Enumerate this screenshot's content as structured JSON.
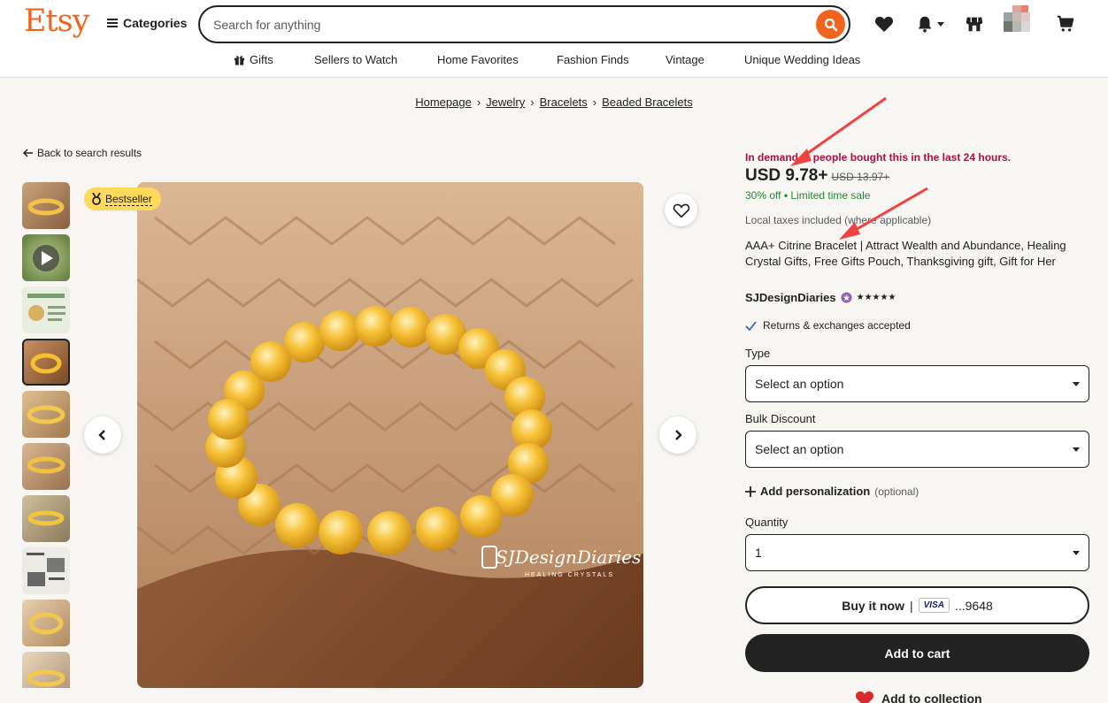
{
  "header": {
    "logo": "Etsy",
    "categories_label": "Categories",
    "search_placeholder": "Search for anything"
  },
  "nav": {
    "items": [
      "Gifts",
      "Sellers to Watch",
      "Home Favorites",
      "Fashion Finds",
      "Vintage",
      "Unique Wedding Ideas"
    ]
  },
  "breadcrumb": [
    "Homepage",
    "Jewelry",
    "Bracelets",
    "Beaded Bracelets"
  ],
  "back_label": "Back to search results",
  "badge": "Bestseller",
  "watermark": {
    "name": "SJDesignDiaries",
    "tagline": "HEALING CRYSTALS"
  },
  "product": {
    "demand": "In demand. 9 people bought this in the last 24 hours.",
    "price": "USD 9.78+",
    "original_price": "USD 13.97+",
    "discount": "30% off",
    "sale_note": "Limited time sale",
    "tax_note": "Local taxes included (where applicable)",
    "title": "AAA+ Citrine Bracelet | Attract Wealth and Abundance, Healing Crystal Gifts, Free Gifts Pouch, Thanksgiving gift, Gift for Her",
    "shop_name": "SJDesignDiaries",
    "rating": 5,
    "stars": "★★★★★",
    "returns": "Returns & exchanges accepted"
  },
  "options": {
    "type_label": "Type",
    "type_value": "Select an option",
    "bulk_label": "Bulk Discount",
    "bulk_value": "Select an option",
    "personalization_label": "Add personalization",
    "personalization_optional": "(optional)",
    "quantity_label": "Quantity",
    "quantity_value": "1"
  },
  "actions": {
    "buy_now": "Buy it now",
    "separator": "|",
    "card_brand": "VISA",
    "card_last4": "...9648",
    "add_to_cart": "Add to cart",
    "add_to_collection": "Add to collection"
  },
  "colors": {
    "brand": "#f1641e",
    "demand": "#b10f3f",
    "discount": "#258635",
    "badge": "#fdd95c",
    "annotation_arrow": "#ef4343"
  }
}
